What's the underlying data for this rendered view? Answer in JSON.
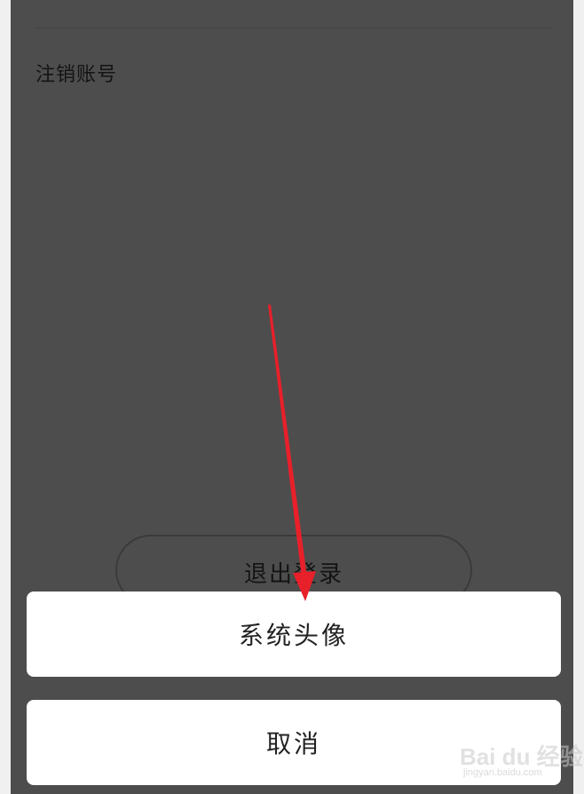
{
  "settings": {
    "deactivate_account_label": "注销账号",
    "logout_button_label": "退出登录"
  },
  "action_sheet": {
    "options": [
      {
        "label": "系统头像"
      }
    ],
    "cancel_label": "取消"
  },
  "annotation": {
    "arrow_color": "#e8202a"
  },
  "watermark": {
    "brand": "Bai du 经验",
    "url": "jingyan.baidu.com"
  },
  "colors": {
    "overlay_background": "#4d4d4d",
    "sheet_background": "#ffffff",
    "outer_background": "#f0f0f0"
  }
}
